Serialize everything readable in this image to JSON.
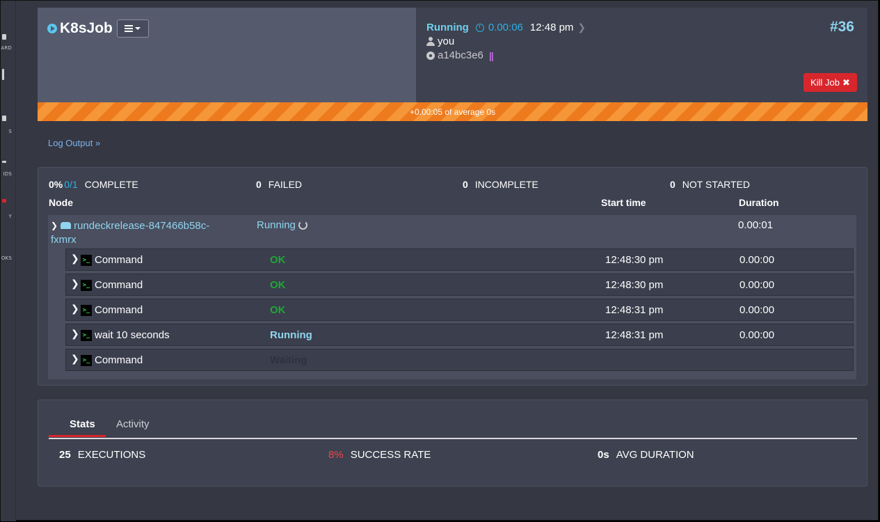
{
  "sidenav": {
    "items": [
      "ARD",
      "S",
      "IDS",
      "Y",
      "OKS"
    ]
  },
  "job": {
    "name": "K8sJob",
    "status": "Running",
    "duration": "0.00:06",
    "time": "12:48 pm",
    "user": "you",
    "commit": "a14bc3e6",
    "exec_number": "#36",
    "kill_label": "Kill Job",
    "kill_icon": "✖",
    "progress_text": "+0.00:05 of average 0s"
  },
  "log_link": "Log Output »",
  "summary": {
    "percent": "0%",
    "fraction": "0/1",
    "complete_label": "COMPLETE",
    "failed_count": "0",
    "failed_label": "FAILED",
    "incomplete_count": "0",
    "incomplete_label": "INCOMPLETE",
    "not_started_count": "0",
    "not_started_label": "NOT STARTED"
  },
  "columns": {
    "node": "Node",
    "start": "Start time",
    "duration": "Duration"
  },
  "node": {
    "name_line1": "rundeckrelease-847466b58c-",
    "name_line2": "fxmrx",
    "status": "Running",
    "duration": "0.00:01"
  },
  "steps": [
    {
      "name": "Command",
      "status": "OK",
      "start": "12:48:30 pm",
      "duration": "0.00:00"
    },
    {
      "name": "Command",
      "status": "OK",
      "start": "12:48:30 pm",
      "duration": "0.00:00"
    },
    {
      "name": "Command",
      "status": "OK",
      "start": "12:48:31 pm",
      "duration": "0.00:00"
    },
    {
      "name": "wait 10 seconds",
      "status": "Running",
      "start": "12:48:31 pm",
      "duration": "0.00:00"
    },
    {
      "name": "Command",
      "status": "Waiting",
      "start": "",
      "duration": ""
    }
  ],
  "colors": {
    "ok": "#1fa63a",
    "running": "#8fd5ef",
    "waiting": "#2f3140"
  },
  "stats": {
    "tabs": [
      "Stats",
      "Activity"
    ],
    "executions_value": "25",
    "executions_label": "EXECUTIONS",
    "success_value": "8%",
    "success_label": "SUCCESS RATE",
    "avg_value": "0s",
    "avg_label": "AVG DURATION"
  }
}
